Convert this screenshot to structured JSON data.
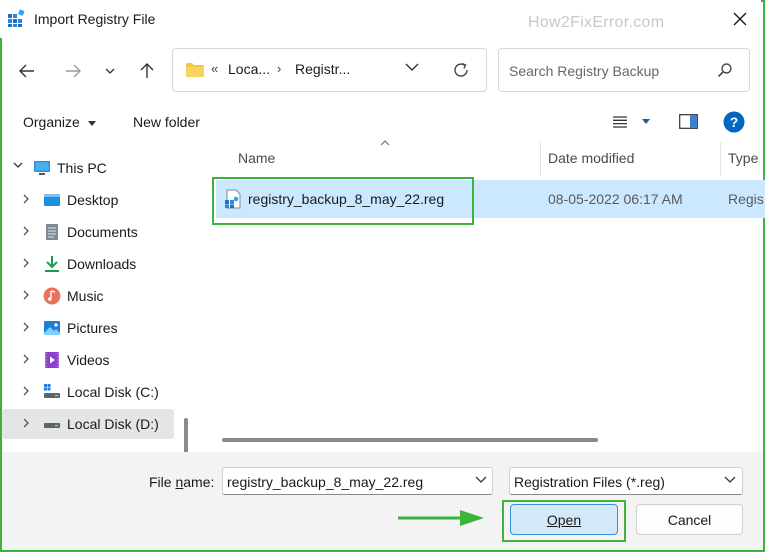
{
  "window": {
    "title": "Import Registry File",
    "watermark": "How2FixError.com"
  },
  "address_bar": {
    "segments": [
      "Loca...",
      "Registr..."
    ],
    "overflow_marker": "«"
  },
  "search": {
    "placeholder": "Search Registry Backup"
  },
  "toolbar": {
    "organize_label": "Organize",
    "new_folder_label": "New folder"
  },
  "nav_pane": {
    "items": [
      {
        "label": "This PC",
        "icon": "computer-icon"
      },
      {
        "label": "Desktop",
        "icon": "desktop-icon"
      },
      {
        "label": "Documents",
        "icon": "documents-icon"
      },
      {
        "label": "Downloads",
        "icon": "downloads-icon"
      },
      {
        "label": "Music",
        "icon": "music-icon"
      },
      {
        "label": "Pictures",
        "icon": "pictures-icon"
      },
      {
        "label": "Videos",
        "icon": "videos-icon"
      },
      {
        "label": "Local Disk (C:)",
        "icon": "drive-icon"
      },
      {
        "label": "Local Disk (D:)",
        "icon": "drive-icon"
      }
    ],
    "selected": "Local Disk (D:)"
  },
  "file_list": {
    "columns": [
      "Name",
      "Date modified",
      "Type"
    ],
    "rows": [
      {
        "name": "registry_backup_8_may_22.reg",
        "date_modified": "08-05-2022 06:17 AM",
        "type": "Regis"
      }
    ]
  },
  "footer": {
    "file_name_label_prefix": "File ",
    "file_name_label_accel": "n",
    "file_name_label_suffix": "ame:",
    "file_name_value": "registry_backup_8_may_22.reg",
    "file_type_value": "Registration Files (*.reg)",
    "open_label": "Open",
    "cancel_label": "Cancel"
  },
  "colors": {
    "highlight_green": "#3cb43c",
    "selection_blue": "#cce8ff",
    "accent_blue": "#0067c0"
  }
}
